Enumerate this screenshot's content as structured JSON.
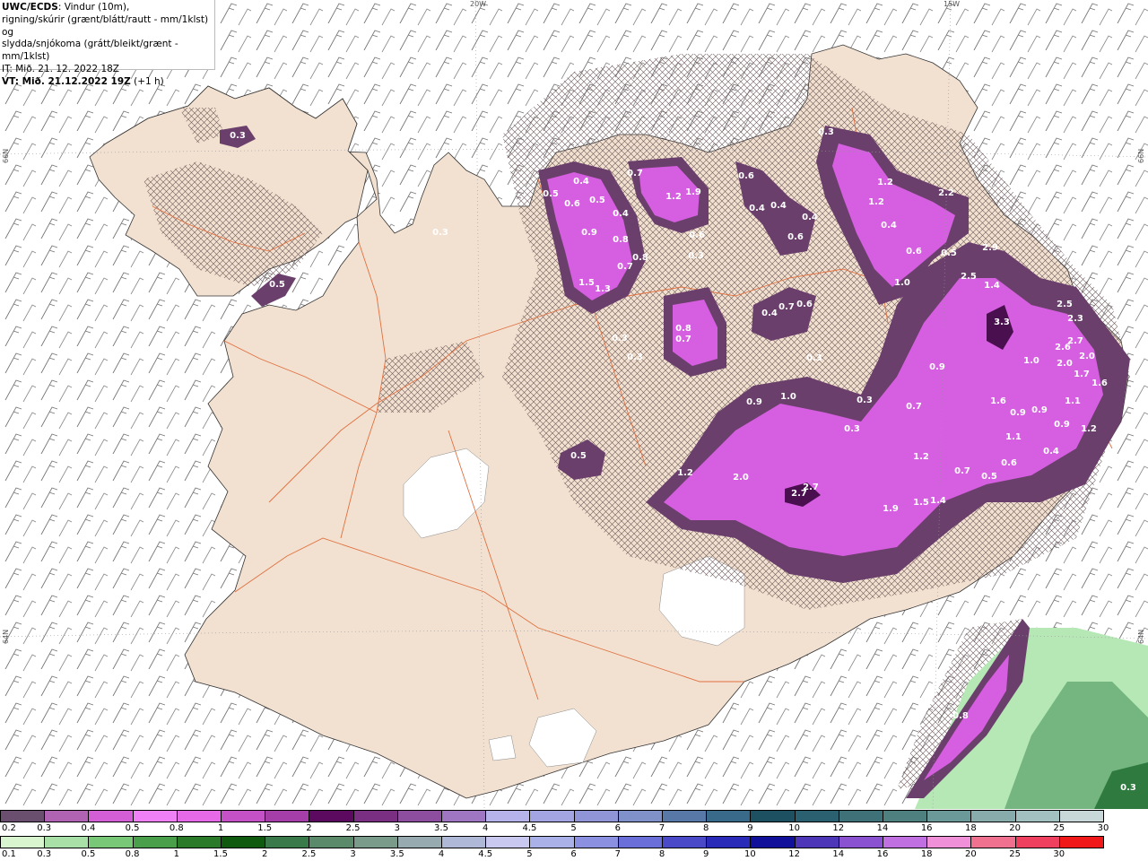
{
  "header": {
    "product": "UWC/ECDS",
    "line1_rest": ": Vindur (10m),",
    "line2": "rigning/skúrir (grænt/blátt/rautt - mm/1klst) og",
    "line3": "slydda/snjókoma (grátt/bleikt/grænt - mm/1klst)",
    "it": "IT: Mið. 21. 12. 2022 18Z",
    "vt_bold": "VT: Mið. 21.12.2022 19Z",
    "vt_rest": " (+1 h)"
  },
  "grid_labels": {
    "lon_20w": "20W",
    "lon_15w": "15W",
    "lat_66n": "66N",
    "lat_64n": "64N"
  },
  "colors": {
    "land": "#f2e1d0",
    "sea": "#ffffff",
    "roads": "#e07040",
    "snow_light": "#6a3f6b",
    "snow_mid": "#a04fa8",
    "snow_high": "#d65ee0",
    "snow_peak": "#ee7ff5",
    "snow_dark": "#4a0f4f",
    "rain_light": "#b5e8b5",
    "rain_mid": "#5aa06a"
  },
  "map_labels": [
    {
      "t": "0.3"
    },
    {
      "t": "0.5"
    },
    {
      "t": "0.3"
    },
    {
      "t": "0.5"
    },
    {
      "t": "0.4"
    },
    {
      "t": "0.6"
    },
    {
      "t": "0.5"
    },
    {
      "t": "0.4"
    },
    {
      "t": "0.9"
    },
    {
      "t": "0.8"
    },
    {
      "t": "0.7"
    },
    {
      "t": "1.3"
    },
    {
      "t": "1.5"
    },
    {
      "t": "0.8"
    },
    {
      "t": "0.7"
    },
    {
      "t": "1.2"
    },
    {
      "t": "1.9"
    },
    {
      "t": "0.6"
    },
    {
      "t": "0.3"
    },
    {
      "t": "0.6"
    },
    {
      "t": "0.4"
    },
    {
      "t": "0.4"
    },
    {
      "t": "0.4"
    },
    {
      "t": "0.6"
    },
    {
      "t": "0.3"
    },
    {
      "t": "1.2"
    },
    {
      "t": "1.2"
    },
    {
      "t": "0.4"
    },
    {
      "t": "2.2"
    },
    {
      "t": "0.6"
    },
    {
      "t": "0.5"
    },
    {
      "t": "1.0"
    },
    {
      "t": "2.9"
    },
    {
      "t": "2.5"
    },
    {
      "t": "1.4"
    },
    {
      "t": "3.3"
    },
    {
      "t": "2.5"
    },
    {
      "t": "2.3"
    },
    {
      "t": "2.6"
    },
    {
      "t": "2.7"
    },
    {
      "t": "2.0"
    },
    {
      "t": "2.0"
    },
    {
      "t": "1.7"
    },
    {
      "t": "1.6"
    },
    {
      "t": "1.0"
    },
    {
      "t": "0.9"
    },
    {
      "t": "0.7"
    },
    {
      "t": "1.6"
    },
    {
      "t": "0.9"
    },
    {
      "t": "0.9"
    },
    {
      "t": "1.1"
    },
    {
      "t": "0.9"
    },
    {
      "t": "1.2"
    },
    {
      "t": "1.1"
    },
    {
      "t": "0.4"
    },
    {
      "t": "0.6"
    },
    {
      "t": "0.5"
    },
    {
      "t": "0.7"
    },
    {
      "t": "1.2"
    },
    {
      "t": "1.5"
    },
    {
      "t": "1.4"
    },
    {
      "t": "1.9"
    },
    {
      "t": "2.7"
    },
    {
      "t": "2.7"
    },
    {
      "t": "2.0"
    },
    {
      "t": "1.2"
    },
    {
      "t": "0.9"
    },
    {
      "t": "1.0"
    },
    {
      "t": "0.3"
    },
    {
      "t": "0.3"
    },
    {
      "t": "0.3"
    },
    {
      "t": "0.4"
    },
    {
      "t": "0.7"
    },
    {
      "t": "0.6"
    },
    {
      "t": "0.8"
    },
    {
      "t": "0.7"
    },
    {
      "t": "0.3"
    },
    {
      "t": "0.3"
    },
    {
      "t": "0.5"
    },
    {
      "t": "0.8"
    },
    {
      "t": "0.3"
    }
  ],
  "legend_snow": {
    "labels": [
      "0.2",
      "0.3",
      "0.4",
      "0.5",
      "0.8",
      "1",
      "1.5",
      "2",
      "2.5",
      "3",
      "3.5",
      "4",
      "4.5",
      "5",
      "6",
      "7",
      "8",
      "9",
      "10",
      "12",
      "14",
      "16",
      "18",
      "20",
      "25",
      "30"
    ],
    "colors": [
      "#6b4f6e",
      "#b063b3",
      "#d35ed6",
      "#f080f5",
      "#e66ae8",
      "#c452c6",
      "#a63ea9",
      "#5b0a5f",
      "#7a2f83",
      "#8e4ea0",
      "#9f76c2",
      "#b6b2ea",
      "#a3a4e2",
      "#8f95d6",
      "#8090c8",
      "#5878a8",
      "#3a6a8a",
      "#1d5060",
      "#2a6070",
      "#3e7278",
      "#4e8080",
      "#6b9898",
      "#88acac",
      "#a3c0c0",
      "#c8d8d8"
    ]
  },
  "legend_rain": {
    "labels": [
      "0.1",
      "0.3",
      "0.5",
      "0.8",
      "1",
      "1.5",
      "2",
      "2.5",
      "3",
      "3.5",
      "4",
      "4.5",
      "5",
      "6",
      "7",
      "8",
      "9",
      "10",
      "12",
      "14",
      "16",
      "18",
      "20",
      "25",
      "30"
    ],
    "colors": [
      "#d8f5d0",
      "#a8e0a8",
      "#78c878",
      "#4aa04a",
      "#2a7a2a",
      "#0f5a0f",
      "#3a7a4a",
      "#5a8a6a",
      "#7a9a8a",
      "#96aab0",
      "#b0b8d8",
      "#c8c8f0",
      "#aab0e8",
      "#8c90e0",
      "#6a6ed8",
      "#4a4ac8",
      "#2a2ab8",
      "#10109a",
      "#4e36b8",
      "#8a52d0",
      "#c070e0",
      "#f090d8",
      "#f07090",
      "#f04060",
      "#f01818"
    ]
  }
}
